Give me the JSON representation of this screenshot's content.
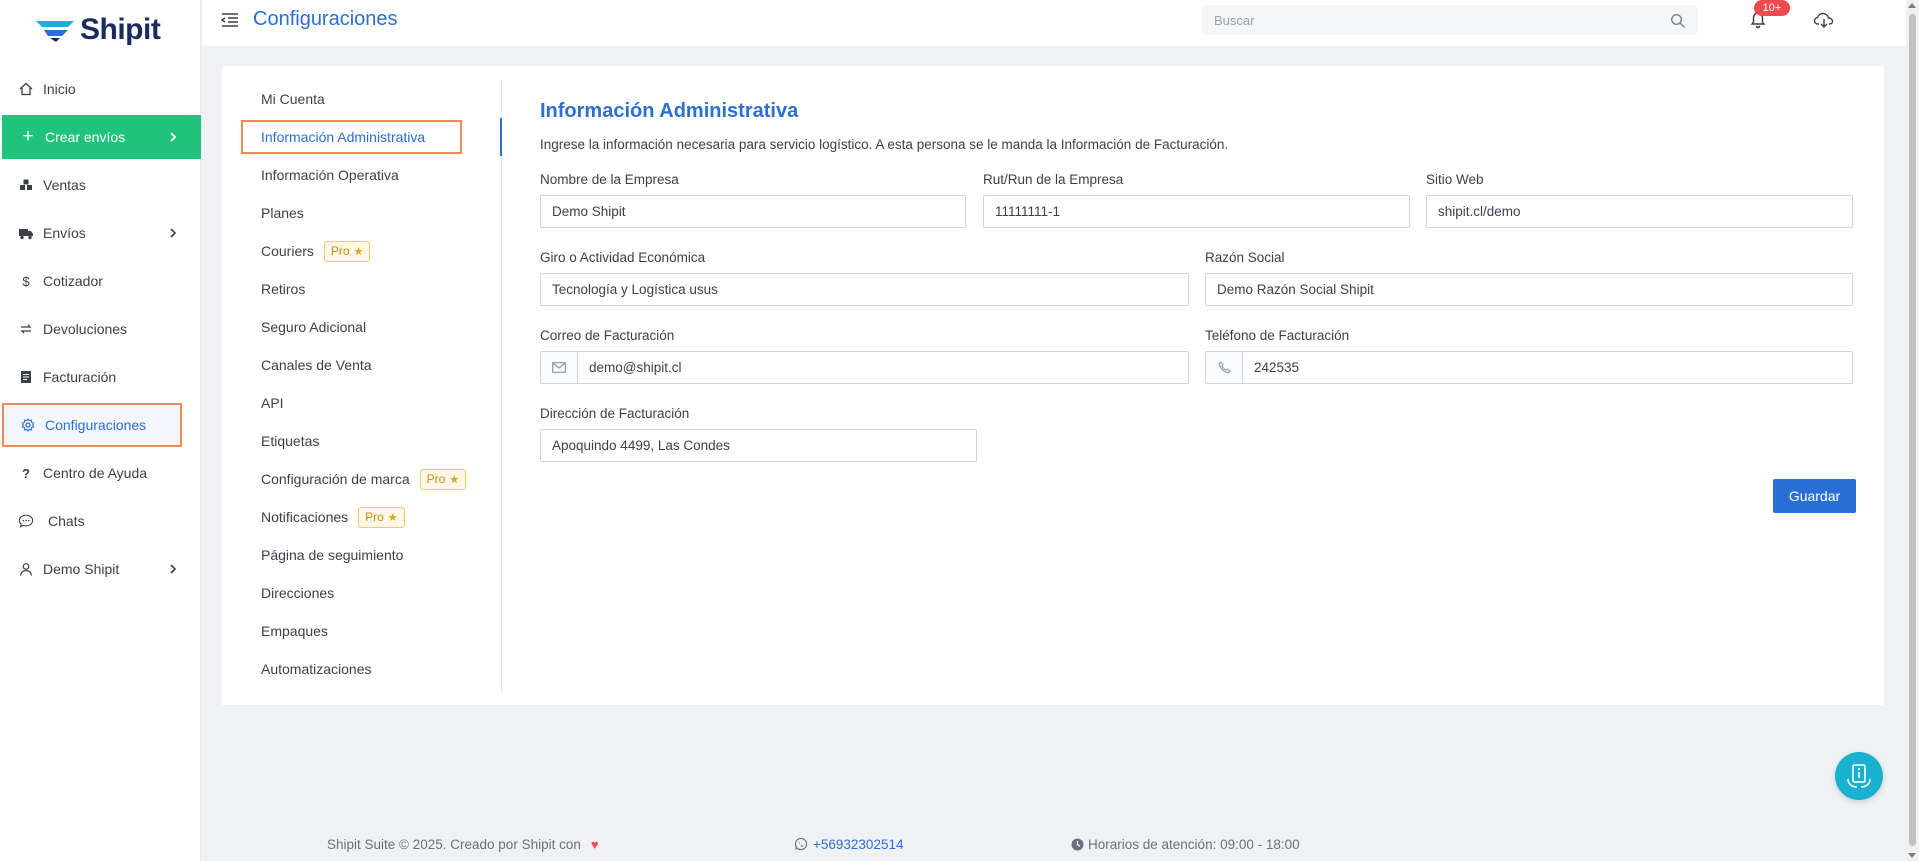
{
  "brand": {
    "name": "Shipit",
    "accent": "#2a6fd6",
    "green": "#1fc37c"
  },
  "sidebar": {
    "items": [
      {
        "label": "Inicio",
        "icon": "home-icon"
      },
      {
        "label": "Crear envíos",
        "icon": "plus-icon"
      },
      {
        "label": "Ventas",
        "icon": "boxes-icon"
      },
      {
        "label": "Envíos",
        "icon": "truck-icon"
      },
      {
        "label": "Cotizador",
        "icon": "dollar-icon"
      },
      {
        "label": "Devoluciones",
        "icon": "return-icon"
      },
      {
        "label": "Facturación",
        "icon": "invoice-icon"
      },
      {
        "label": "Configuraciones",
        "icon": "gear-icon"
      },
      {
        "label": "Centro de Ayuda",
        "icon": "question-icon"
      },
      {
        "label": "Chats",
        "icon": "chat-icon"
      },
      {
        "label": "Demo Shipit",
        "icon": "user-icon"
      }
    ]
  },
  "topbar": {
    "title": "Configuraciones",
    "search_placeholder": "Buscar",
    "notifications_badge": "10+"
  },
  "submenu": {
    "items": [
      {
        "label": "Mi Cuenta"
      },
      {
        "label": "Información Administrativa"
      },
      {
        "label": "Información Operativa"
      },
      {
        "label": "Planes"
      },
      {
        "label": "Couriers",
        "badge": "Pro"
      },
      {
        "label": "Retiros"
      },
      {
        "label": "Seguro Adicional"
      },
      {
        "label": "Canales de Venta"
      },
      {
        "label": "API"
      },
      {
        "label": "Etiquetas"
      },
      {
        "label": "Configuración de marca",
        "badge": "Pro"
      },
      {
        "label": "Notificaciones",
        "badge": "Pro"
      },
      {
        "label": "Página de seguimiento"
      },
      {
        "label": "Direcciones"
      },
      {
        "label": "Empaques"
      },
      {
        "label": "Automatizaciones"
      }
    ]
  },
  "form": {
    "title": "Información Administrativa",
    "description": "Ingrese la información necesaria para servicio logístico. A esta persona se le manda la Información de Facturación.",
    "fields": {
      "company_name": {
        "label": "Nombre de la Empresa",
        "value": "Demo Shipit"
      },
      "rut": {
        "label": "Rut/Run de la Empresa",
        "value": "11111111-1"
      },
      "website": {
        "label": "Sitio Web",
        "value": "shipit.cl/demo"
      },
      "business_activity": {
        "label": "Giro o Actividad Económica",
        "value": "Tecnología y Logística usus"
      },
      "legal_name": {
        "label": "Razón Social",
        "value": "Demo Razón Social Shipit"
      },
      "billing_email": {
        "label": "Correo de Facturación",
        "value": "demo@shipit.cl"
      },
      "billing_phone": {
        "label": "Teléfono de Facturación",
        "value": "242535"
      },
      "billing_address": {
        "label": "Dirección de Facturación",
        "value": "Apoquindo 4499, Las Condes"
      }
    },
    "save_label": "Guardar"
  },
  "footer": {
    "copyright": "Shipit Suite © 2025. Creado por Shipit con",
    "phone": "+56932302514",
    "hours": "Horarios de atención: 09:00 - 18:00"
  }
}
